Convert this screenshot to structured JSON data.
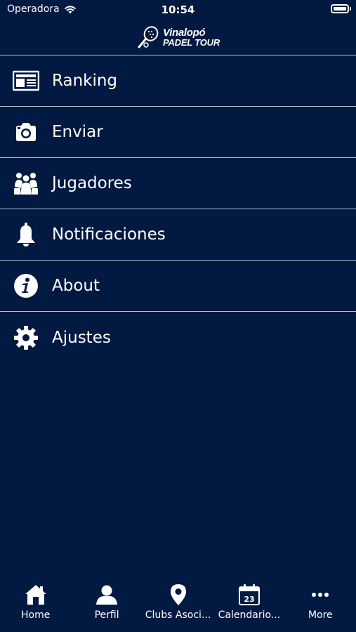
{
  "status_bar": {
    "carrier": "Operadora",
    "time": "10:54"
  },
  "header": {
    "logo_line1": "Vinalopó",
    "logo_line2": "PADEL TOUR"
  },
  "menu": [
    {
      "label": "Ranking",
      "icon": "newspaper-icon"
    },
    {
      "label": "Enviar",
      "icon": "camera-icon"
    },
    {
      "label": "Jugadores",
      "icon": "players-icon"
    },
    {
      "label": "Notificaciones",
      "icon": "bell-icon"
    },
    {
      "label": "About",
      "icon": "info-icon"
    },
    {
      "label": "Ajustes",
      "icon": "gear-icon"
    }
  ],
  "tab_bar": [
    {
      "label": "Home",
      "icon": "home-icon"
    },
    {
      "label": "Perfil",
      "icon": "profile-icon"
    },
    {
      "label": "Clubs Asoci...",
      "icon": "location-pin-icon"
    },
    {
      "label": "Calendario...",
      "icon": "calendar-icon"
    },
    {
      "label": "More",
      "icon": "more-icon"
    }
  ],
  "calendar_day": "23",
  "colors": {
    "background": "#021941",
    "divider": "#b8c0cc",
    "text": "#ffffff"
  }
}
